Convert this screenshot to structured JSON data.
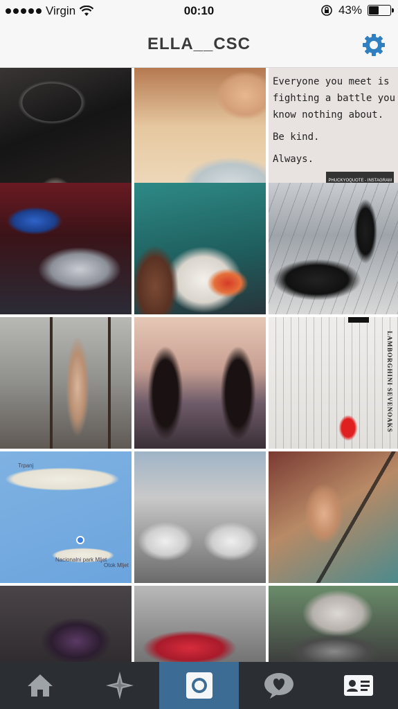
{
  "status_bar": {
    "carrier": "Virgin",
    "time": "00:10",
    "battery_percent": "43%",
    "battery_level": 0.43
  },
  "header": {
    "title": "ELLA__CSC",
    "settings_icon": "gear-icon"
  },
  "quote_tile": {
    "lines": [
      "Everyone you meet is",
      "fighting a battle you",
      "know nothing about.",
      "Be kind.",
      "Always."
    ],
    "credit": "PHUCKYOQUOTE - INSTAGRAM"
  },
  "map_tile": {
    "labels": [
      "Trpanj",
      "Nacionalni park Mljet",
      "Otok Mljet"
    ]
  },
  "document_tile": {
    "label": "LAMBORGHINI SEVENOAKS"
  },
  "tabbar": {
    "tabs": [
      {
        "name": "home",
        "icon": "home-icon"
      },
      {
        "name": "explore",
        "icon": "compass-star-icon"
      },
      {
        "name": "camera",
        "icon": "camera-icon",
        "active": true
      },
      {
        "name": "activity",
        "icon": "heart-bubble-icon"
      },
      {
        "name": "profile",
        "icon": "profile-card-icon"
      }
    ]
  },
  "colors": {
    "accent": "#3c6c94",
    "tabbar": "#2b2f33",
    "header_bg": "#f7f7f7",
    "gear": "#2f7fc1"
  }
}
